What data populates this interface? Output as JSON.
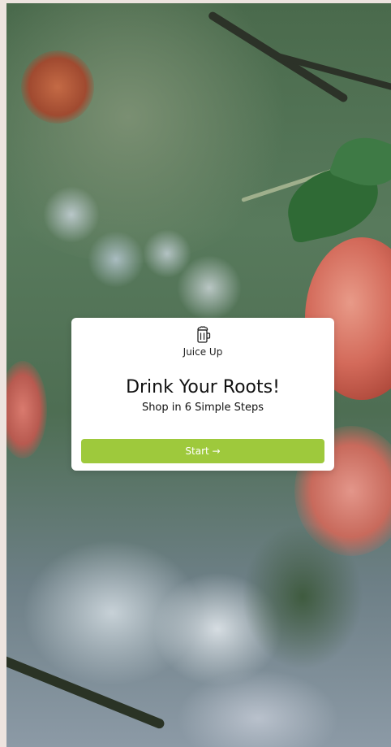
{
  "card": {
    "brand": "Juice Up",
    "headline": "Drink Your Roots!",
    "subline": "Shop in 6 Simple Steps",
    "start_label": "Start →"
  },
  "icons": {
    "logo": "beer-mug-icon"
  },
  "colors": {
    "accent": "#9ec93c",
    "card_bg": "#ffffff",
    "page_bg": "#ede4df"
  }
}
